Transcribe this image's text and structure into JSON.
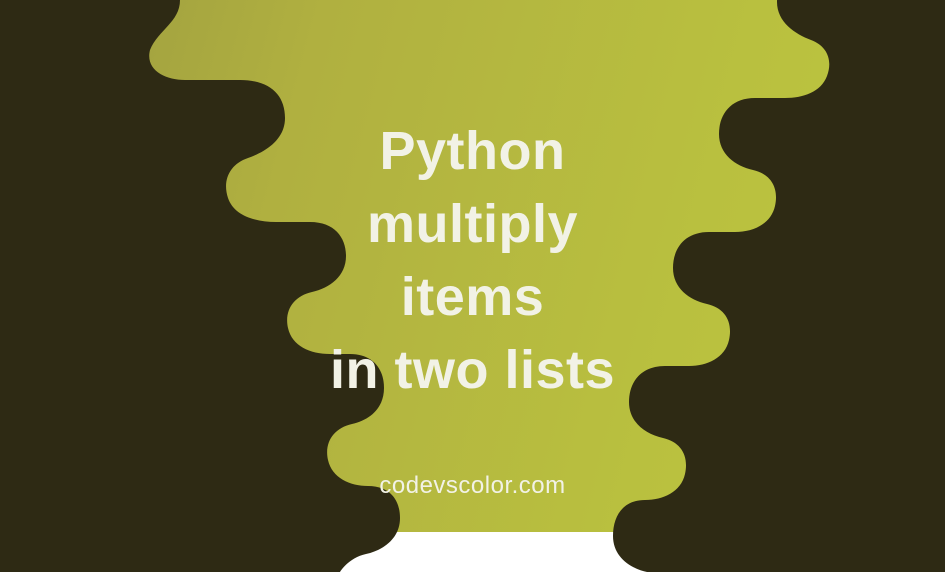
{
  "title_line1": "Python",
  "title_line2": "multiply",
  "title_line3": "items",
  "title_line4": "in two lists",
  "watermark": "codevscolor.com",
  "colors": {
    "blob": "#2e2a14",
    "text": "#f2f2e6",
    "bg_left": "#9a9a3f",
    "bg_right": "#bfc740"
  }
}
